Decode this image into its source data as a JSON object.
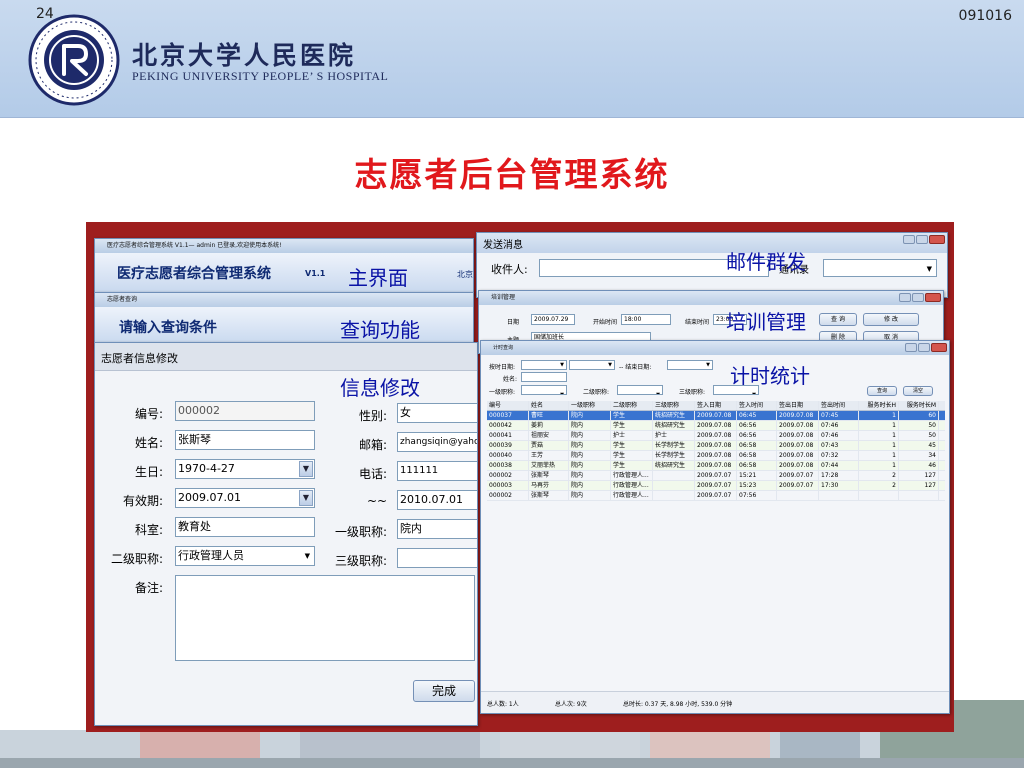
{
  "slide": {
    "number": "24",
    "code": "091016",
    "title": "志愿者后台管理系统"
  },
  "hospital": {
    "name_cn": "北京大学人民医院",
    "name_en": "PEKING UNIVERSITY PEOPLE’ S HOSPITAL"
  },
  "annotations": {
    "main_ui": "主界面",
    "query": "查询功能",
    "info_edit": "信息修改",
    "email": "邮件群发",
    "training": "培训管理",
    "time_stats": "计时统计"
  },
  "main_window": {
    "titlebar": "医疗志愿者综合管理系统 V1.1— admin 已登录,欢迎使用本系统!",
    "app_title": "医疗志愿者综合管理系统",
    "version": "V1.1",
    "org_partial": "北京"
  },
  "query_window": {
    "titlebar": "志愿者查询",
    "heading": "请输入查询条件"
  },
  "edit_window": {
    "heading": "志愿者信息修改",
    "fields": {
      "id_label": "编号:",
      "id_value": "000002",
      "name_label": "姓名:",
      "name_value": "张斯琴",
      "birthday_label": "生日:",
      "birthday_value": "1970-4-27",
      "valid_label": "有效期:",
      "valid_from": "2009.07.01",
      "range_sep": "~~",
      "valid_to": "2010.07.01",
      "dept_label": "科室:",
      "dept_value": "教育处",
      "title2_label": "二级职称:",
      "title2_value": "行政管理人员",
      "gender_label": "性别:",
      "gender_value": "女",
      "email_label": "邮箱:",
      "email_value": "zhangsiqin@yahoo",
      "phone_label": "电话:",
      "phone_value": "111111",
      "title1_label": "一级职称:",
      "title1_value": "院内",
      "title3_label": "三级职称:",
      "title3_value": "",
      "notes_label": "备注:"
    },
    "done_button": "完成"
  },
  "email_window": {
    "title": "发送消息",
    "recipient_label": "收件人:",
    "contacts_label": "通讯录"
  },
  "training_window": {
    "titlebar": "培训管理",
    "date_label": "日期",
    "date_value": "2009.07.29",
    "start_label": "开始时间",
    "start_value": "18:00",
    "end_label": "结束时间",
    "end_value": "23:00",
    "subject_label": "主题",
    "subject_value": "国储加班长",
    "modify_button": "修 改",
    "cancel_button": "取 消",
    "query_button": "查 询",
    "delete_button": "删 除"
  },
  "stats_window": {
    "titlebar": "计时查询",
    "start_date_label": "按时日期:",
    "end_date_label": "-- 结束日期:",
    "name_label": "姓名:",
    "title1_label": "一级职称:",
    "title2_label": "二级职称:",
    "title3_label": "三级职称:",
    "query_button": "查询",
    "clear_button": "清空",
    "columns": [
      "编号",
      "姓名",
      "一级职称",
      "二级职称",
      "三级职称",
      "签入日期",
      "签入时间",
      "签出日期",
      "签出时间",
      "服务时长H",
      "服务时长M"
    ],
    "rows": [
      [
        "000037",
        "曹旺",
        "院内",
        "学生",
        "统招研究生",
        "2009.07.08",
        "06:45",
        "2009.07.08",
        "07:45",
        "1",
        "60"
      ],
      [
        "000042",
        "姜莉",
        "院内",
        "学生",
        "统招研究生",
        "2009.07.08",
        "06:56",
        "2009.07.08",
        "07:46",
        "1",
        "50"
      ],
      [
        "000041",
        "祖丽安",
        "院内",
        "护士",
        "护士",
        "2009.07.08",
        "06:56",
        "2009.07.08",
        "07:46",
        "1",
        "50"
      ],
      [
        "000039",
        "贾菇",
        "院内",
        "学生",
        "长学制学生",
        "2009.07.08",
        "06:58",
        "2009.07.08",
        "07:43",
        "1",
        "45"
      ],
      [
        "000040",
        "王芳",
        "院内",
        "学生",
        "长学制学生",
        "2009.07.08",
        "06:58",
        "2009.07.08",
        "07:32",
        "1",
        "34"
      ],
      [
        "000038",
        "艾丽菲热",
        "院内",
        "学生",
        "统招研究生",
        "2009.07.08",
        "06:58",
        "2009.07.08",
        "07:44",
        "1",
        "46"
      ],
      [
        "000002",
        "张斯琴",
        "院内",
        "行政管理人...",
        "",
        "2009.07.07",
        "15:21",
        "2009.07.07",
        "17:28",
        "2",
        "127"
      ],
      [
        "000003",
        "马再芬",
        "院内",
        "行政管理人...",
        "",
        "2009.07.07",
        "15:23",
        "2009.07.07",
        "17:30",
        "2",
        "127"
      ],
      [
        "000002",
        "张斯琴",
        "院内",
        "行政管理人...",
        "",
        "2009.07.07",
        "07:56",
        "",
        "",
        "",
        ""
      ]
    ],
    "footer": {
      "total_count": "总人数: 1人",
      "total_visits": "总人次: 9次",
      "total_time": "总时长: 0.37 天, 8.98 小时, 539.0 分钟"
    }
  },
  "colors": {
    "title_red": "#e1181c",
    "annotation_blue": "#0a13a6",
    "header_bg": "#b3cbe8",
    "frame_red": "#9e1e1e",
    "selected_row": "#3a74d0"
  }
}
